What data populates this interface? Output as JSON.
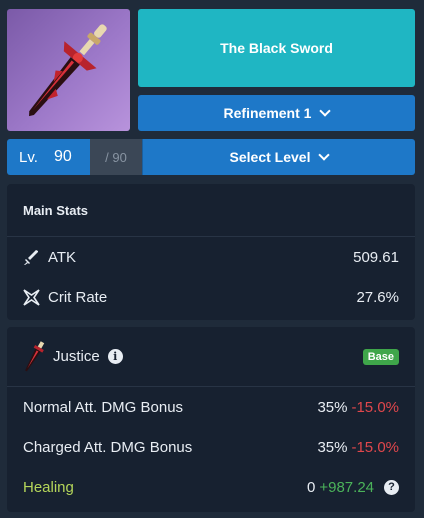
{
  "weapon": {
    "name": "The Black Sword",
    "image_icon": "sword-icon"
  },
  "refinement": {
    "label": "Refinement 1"
  },
  "level": {
    "prefix": "Lv.",
    "value": "90",
    "max": "/ 90",
    "select_label": "Select Level"
  },
  "main_stats": {
    "title": "Main Stats",
    "rows": [
      {
        "icon": "sword-stat-icon",
        "label": "ATK",
        "value": "509.61"
      },
      {
        "icon": "crit-star-icon",
        "label": "Crit Rate",
        "value": "27.6%"
      }
    ]
  },
  "passive": {
    "name": "Justice",
    "badge": "Base",
    "rows": [
      {
        "label": "Normal Att. DMG Bonus",
        "value": "35%",
        "delta": "-15.0%"
      },
      {
        "label": "Charged Att. DMG Bonus",
        "value": "35%",
        "delta": "-15.0%"
      },
      {
        "label": "Healing",
        "value": "0",
        "delta": "+987.24"
      }
    ]
  },
  "colors": {
    "accent_blue": "#1e78c8",
    "teal": "#1fb6c3",
    "negative": "#e0474c",
    "positive": "#4bb35a",
    "healing": "#b5d65a"
  }
}
